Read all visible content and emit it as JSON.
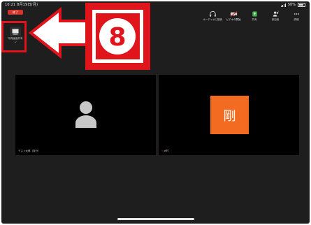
{
  "status_bar": {
    "time": "10:21 8月19日(月)",
    "battery": "50%"
  },
  "end_button": {
    "label": "終了"
  },
  "toolbar": {
    "items": [
      {
        "label": "オーディオに接続",
        "icon": "headphones-icon"
      },
      {
        "label": "ビデオの開始",
        "icon": "video-off-icon"
      },
      {
        "label": "共有",
        "icon": "share-icon"
      },
      {
        "label": "参加者",
        "icon": "participants-icon"
      },
      {
        "label": "詳細",
        "icon": "more-icon"
      }
    ]
  },
  "share_button": {
    "label": "写真画面共有 ン",
    "icon": "screen-share-icon"
  },
  "callout": {
    "number": "8",
    "color": "#e0141b"
  },
  "tiles": [
    {
      "caption": "テスト太郎（自分）",
      "avatar": "person-silhouette"
    },
    {
      "caption": "大村",
      "avatar_char": "剛",
      "avatar_color": "#f26b20",
      "muted": true
    }
  ]
}
